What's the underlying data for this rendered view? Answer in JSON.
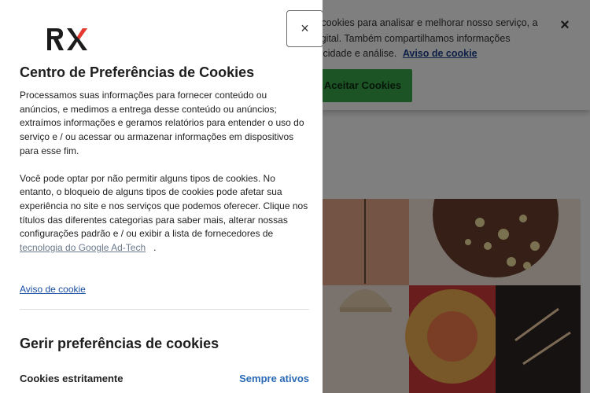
{
  "banner": {
    "text": "e cookies para analisar e melhorar nosso serviço, a digital. Também compartilhamos informações blicidade e análise.",
    "cookie_notice_link": "Aviso de cookie",
    "accept_button": "Aceitar Cookies",
    "close_icon": "×"
  },
  "panel": {
    "logo": "RX",
    "close_icon": "×",
    "title": "Centro de Preferências de Cookies",
    "paragraph1": "Processamos suas informações para fornecer conteúdo ou anúncios, e medimos a entrega desse conteúdo ou anúncios; extraímos informações e geramos relatórios para entender o uso do serviço e / ou acessar ou armazenar informações em dispositivos para esse fim.",
    "paragraph2": "Você pode optar por não permitir alguns tipos de cookies. No entanto, o bloqueio de alguns tipos de cookies pode afetar sua experiência no site e nos serviços que podemos oferecer. Clique nos títulos das diferentes categorias para saber mais, alterar nossas configurações padrão e / ou exibir a lista de fornecedores de",
    "adtech_link": "tecnologia do Google Ad-Tech",
    "paragraph2_end": ".",
    "notice_link": "Aviso de cookie",
    "manage_title": "Gerir preferências de cookies",
    "categories": [
      {
        "name": "Cookies estritamente",
        "status": "Sempre ativos"
      }
    ]
  },
  "colors": {
    "accent": "#3aa84a",
    "link": "#1a4fa3",
    "overlay": "rgba(0,0,0,0.5)"
  },
  "icons": {
    "close": "close-icon",
    "banner_close": "close-icon",
    "logo": "rx-logo"
  }
}
